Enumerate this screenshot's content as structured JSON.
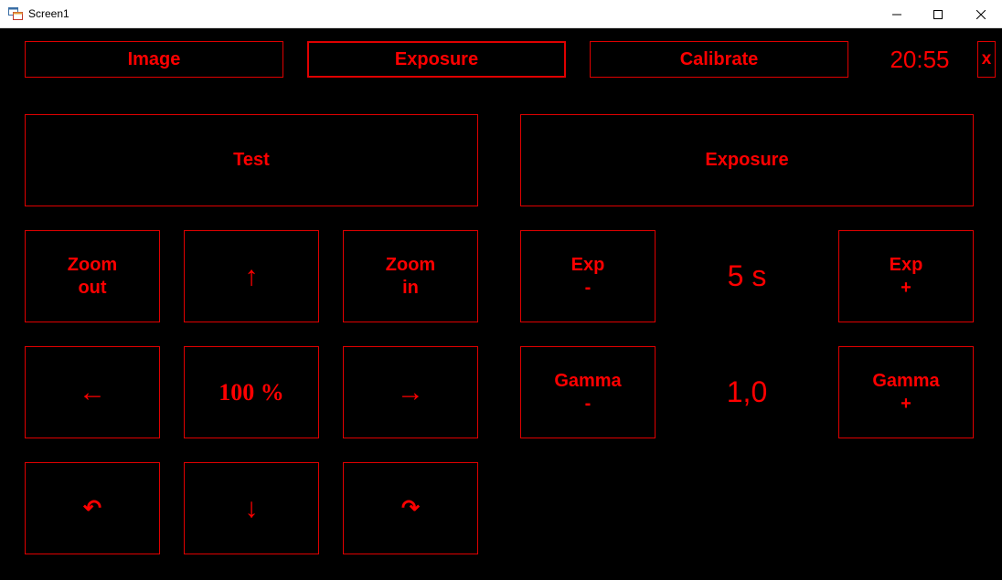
{
  "window": {
    "title": "Screen1"
  },
  "tabs": {
    "image": "Image",
    "exposure": "Exposure",
    "calibrate": "Calibrate"
  },
  "clock": "20:55",
  "close_label": "x",
  "left": {
    "test": "Test",
    "zoom_out": [
      "Zoom",
      "out"
    ],
    "up": "↑",
    "zoom_in": [
      "Zoom",
      "in"
    ],
    "left": "←",
    "zoom_level": "100 %",
    "right": "→",
    "rotate_left": "↶",
    "down": "↓",
    "rotate_right": "↷"
  },
  "right": {
    "exposure": "Exposure",
    "exp_minus": [
      "Exp",
      "-"
    ],
    "exp_value": "5 s",
    "exp_plus": [
      "Exp",
      "+"
    ],
    "gamma_minus": [
      "Gamma",
      "-"
    ],
    "gamma_value": "1,0",
    "gamma_plus": [
      "Gamma",
      "+"
    ]
  },
  "colors": {
    "accent": "#ff0000",
    "border": "#e00000",
    "background": "#000000"
  }
}
